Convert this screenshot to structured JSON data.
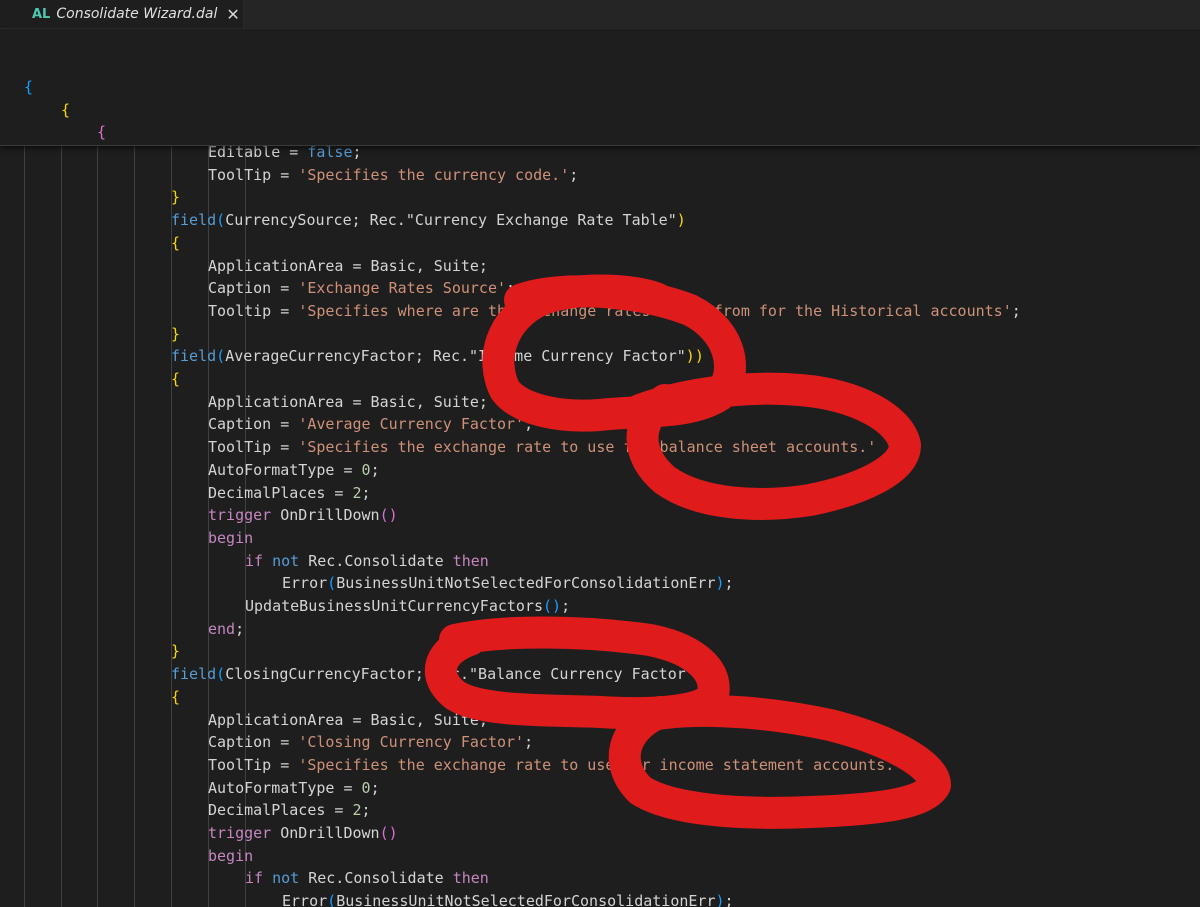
{
  "tab": {
    "language": "AL",
    "title": "Consolidate Wizard.dal",
    "close": "✕"
  },
  "sticky_scroll": [
    "{",
    "{",
    "{"
  ],
  "code_lines": [
    {
      "indent": 2,
      "tokens": [
        {
          "t": "Editable",
          "c": "plain"
        },
        {
          "t": " = ",
          "c": "plain"
        },
        {
          "t": "false",
          "c": "kw"
        },
        {
          "t": ";",
          "c": "plain"
        }
      ]
    },
    {
      "indent": 2,
      "tokens": [
        {
          "t": "ToolTip",
          "c": "plain"
        },
        {
          "t": " = ",
          "c": "plain"
        },
        {
          "t": "'Specifies the currency code.'",
          "c": "str"
        },
        {
          "t": ";",
          "c": "plain"
        }
      ]
    },
    {
      "indent": 1,
      "tokens": [
        {
          "t": "}",
          "c": "br1"
        }
      ]
    },
    {
      "indent": 1,
      "tokens": [
        {
          "t": "field",
          "c": "kw"
        },
        {
          "t": "(",
          "c": "br3"
        },
        {
          "t": "CurrencySource; Rec.",
          "c": "plain"
        },
        {
          "t": "\"Currency Exchange Rate Table\"",
          "c": "plain"
        },
        {
          "t": ")",
          "c": "br1"
        }
      ]
    },
    {
      "indent": 1,
      "tokens": [
        {
          "t": "{",
          "c": "br1"
        }
      ]
    },
    {
      "indent": 2,
      "tokens": [
        {
          "t": "ApplicationArea",
          "c": "plain"
        },
        {
          "t": " = Basic, Suite;",
          "c": "plain"
        }
      ]
    },
    {
      "indent": 2,
      "tokens": [
        {
          "t": "Caption",
          "c": "plain"
        },
        {
          "t": " = ",
          "c": "plain"
        },
        {
          "t": "'Exchange Rates Source'",
          "c": "str"
        },
        {
          "t": ";",
          "c": "plain"
        }
      ]
    },
    {
      "indent": 2,
      "tokens": [
        {
          "t": "Tooltip",
          "c": "plain"
        },
        {
          "t": " = ",
          "c": "plain"
        },
        {
          "t": "'Specifies where are the exchange rates taken from for the Historical accounts'",
          "c": "str"
        },
        {
          "t": ";",
          "c": "plain"
        }
      ]
    },
    {
      "indent": 1,
      "tokens": [
        {
          "t": "}",
          "c": "br1"
        }
      ]
    },
    {
      "indent": 1,
      "tokens": [
        {
          "t": "field",
          "c": "kw"
        },
        {
          "t": "(",
          "c": "br3"
        },
        {
          "t": "AverageCurrencyFactor; Rec.",
          "c": "plain"
        },
        {
          "t": "\"Income Currency Factor\"",
          "c": "plain"
        },
        {
          "t": ")",
          "c": "br1"
        },
        {
          "t": ")",
          "c": "br1"
        }
      ]
    },
    {
      "indent": 1,
      "tokens": [
        {
          "t": "{",
          "c": "br1"
        }
      ]
    },
    {
      "indent": 2,
      "tokens": [
        {
          "t": "ApplicationArea",
          "c": "plain"
        },
        {
          "t": " = Basic, Suite;",
          "c": "plain"
        }
      ]
    },
    {
      "indent": 2,
      "tokens": [
        {
          "t": "Caption",
          "c": "plain"
        },
        {
          "t": " = ",
          "c": "plain"
        },
        {
          "t": "'Average Currency Factor'",
          "c": "str"
        },
        {
          "t": ";",
          "c": "plain"
        }
      ]
    },
    {
      "indent": 2,
      "tokens": [
        {
          "t": "ToolTip",
          "c": "plain"
        },
        {
          "t": " = ",
          "c": "plain"
        },
        {
          "t": "'Specifies the exchange rate to use for balance sheet accounts.'",
          "c": "str"
        }
      ]
    },
    {
      "indent": 2,
      "tokens": [
        {
          "t": "AutoFormatType",
          "c": "plain"
        },
        {
          "t": " = ",
          "c": "plain"
        },
        {
          "t": "0",
          "c": "num"
        },
        {
          "t": ";",
          "c": "plain"
        }
      ]
    },
    {
      "indent": 2,
      "tokens": [
        {
          "t": "DecimalPlaces",
          "c": "plain"
        },
        {
          "t": " = ",
          "c": "plain"
        },
        {
          "t": "2",
          "c": "num"
        },
        {
          "t": ";",
          "c": "plain"
        }
      ]
    },
    {
      "indent": 2,
      "tokens": [
        {
          "t": "trigger",
          "c": "kwc"
        },
        {
          "t": " ",
          "c": "plain"
        },
        {
          "t": "OnDrillDown",
          "c": "plain"
        },
        {
          "t": "()",
          "c": "br2"
        }
      ]
    },
    {
      "indent": 2,
      "tokens": [
        {
          "t": "begin",
          "c": "kwc"
        }
      ]
    },
    {
      "indent": 3,
      "tokens": [
        {
          "t": "if",
          "c": "kwc"
        },
        {
          "t": " ",
          "c": "plain"
        },
        {
          "t": "not",
          "c": "kw"
        },
        {
          "t": " Rec.Consolidate ",
          "c": "plain"
        },
        {
          "t": "then",
          "c": "kwc"
        }
      ]
    },
    {
      "indent": 4,
      "tokens": [
        {
          "t": "Error",
          "c": "plain"
        },
        {
          "t": "(",
          "c": "br3"
        },
        {
          "t": "BusinessUnitNotSelectedForConsolidationErr",
          "c": "plain"
        },
        {
          "t": ")",
          "c": "br3"
        },
        {
          "t": ";",
          "c": "plain"
        }
      ]
    },
    {
      "indent": 3,
      "tokens": [
        {
          "t": "UpdateBusinessUnitCurrencyFactors",
          "c": "plain"
        },
        {
          "t": "()",
          "c": "br3"
        },
        {
          "t": ";",
          "c": "plain"
        }
      ]
    },
    {
      "indent": 2,
      "tokens": [
        {
          "t": "end",
          "c": "kwc"
        },
        {
          "t": ";",
          "c": "plain"
        }
      ]
    },
    {
      "indent": 1,
      "tokens": [
        {
          "t": "}",
          "c": "br1"
        }
      ]
    },
    {
      "indent": 1,
      "tokens": [
        {
          "t": "field",
          "c": "kw"
        },
        {
          "t": "(",
          "c": "br3"
        },
        {
          "t": "ClosingCurrencyFactor; Rec.",
          "c": "plain"
        },
        {
          "t": "\"Balance Currency Factor\"",
          "c": "plain"
        },
        {
          "t": ")",
          "c": "br1"
        }
      ]
    },
    {
      "indent": 1,
      "tokens": [
        {
          "t": "{",
          "c": "br1"
        }
      ]
    },
    {
      "indent": 2,
      "tokens": [
        {
          "t": "ApplicationArea",
          "c": "plain"
        },
        {
          "t": " = Basic, Suite;",
          "c": "plain"
        }
      ]
    },
    {
      "indent": 2,
      "tokens": [
        {
          "t": "Caption",
          "c": "plain"
        },
        {
          "t": " = ",
          "c": "plain"
        },
        {
          "t": "'Closing Currency Factor'",
          "c": "str"
        },
        {
          "t": ";",
          "c": "plain"
        }
      ]
    },
    {
      "indent": 2,
      "tokens": [
        {
          "t": "ToolTip",
          "c": "plain"
        },
        {
          "t": " = ",
          "c": "plain"
        },
        {
          "t": "'Specifies the exchange rate to use for income statement accounts.'",
          "c": "str"
        },
        {
          "t": ";",
          "c": "plain"
        }
      ]
    },
    {
      "indent": 2,
      "tokens": [
        {
          "t": "AutoFormatType",
          "c": "plain"
        },
        {
          "t": " = ",
          "c": "plain"
        },
        {
          "t": "0",
          "c": "num"
        },
        {
          "t": ";",
          "c": "plain"
        }
      ]
    },
    {
      "indent": 2,
      "tokens": [
        {
          "t": "DecimalPlaces",
          "c": "plain"
        },
        {
          "t": " = ",
          "c": "plain"
        },
        {
          "t": "2",
          "c": "num"
        },
        {
          "t": ";",
          "c": "plain"
        }
      ]
    },
    {
      "indent": 2,
      "tokens": [
        {
          "t": "trigger",
          "c": "kwc"
        },
        {
          "t": " ",
          "c": "plain"
        },
        {
          "t": "OnDrillDown",
          "c": "plain"
        },
        {
          "t": "()",
          "c": "br2"
        }
      ]
    },
    {
      "indent": 2,
      "tokens": [
        {
          "t": "begin",
          "c": "kwc"
        }
      ]
    },
    {
      "indent": 3,
      "tokens": [
        {
          "t": "if",
          "c": "kwc"
        },
        {
          "t": " ",
          "c": "plain"
        },
        {
          "t": "not",
          "c": "kw"
        },
        {
          "t": " Rec.Consolidate ",
          "c": "plain"
        },
        {
          "t": "then",
          "c": "kwc"
        }
      ]
    },
    {
      "indent": 4,
      "tokens": [
        {
          "t": "Error",
          "c": "plain"
        },
        {
          "t": "(",
          "c": "br3"
        },
        {
          "t": "BusinessUnitNotSelectedForConsolidationErr",
          "c": "plain"
        },
        {
          "t": ")",
          "c": "br3"
        },
        {
          "t": ";",
          "c": "plain"
        }
      ]
    }
  ],
  "colors": {
    "background": "#1e1e1e",
    "redaction": "#e01b1b",
    "string": "#ce9178",
    "keyword": "#569cd6",
    "control": "#c586c0"
  }
}
